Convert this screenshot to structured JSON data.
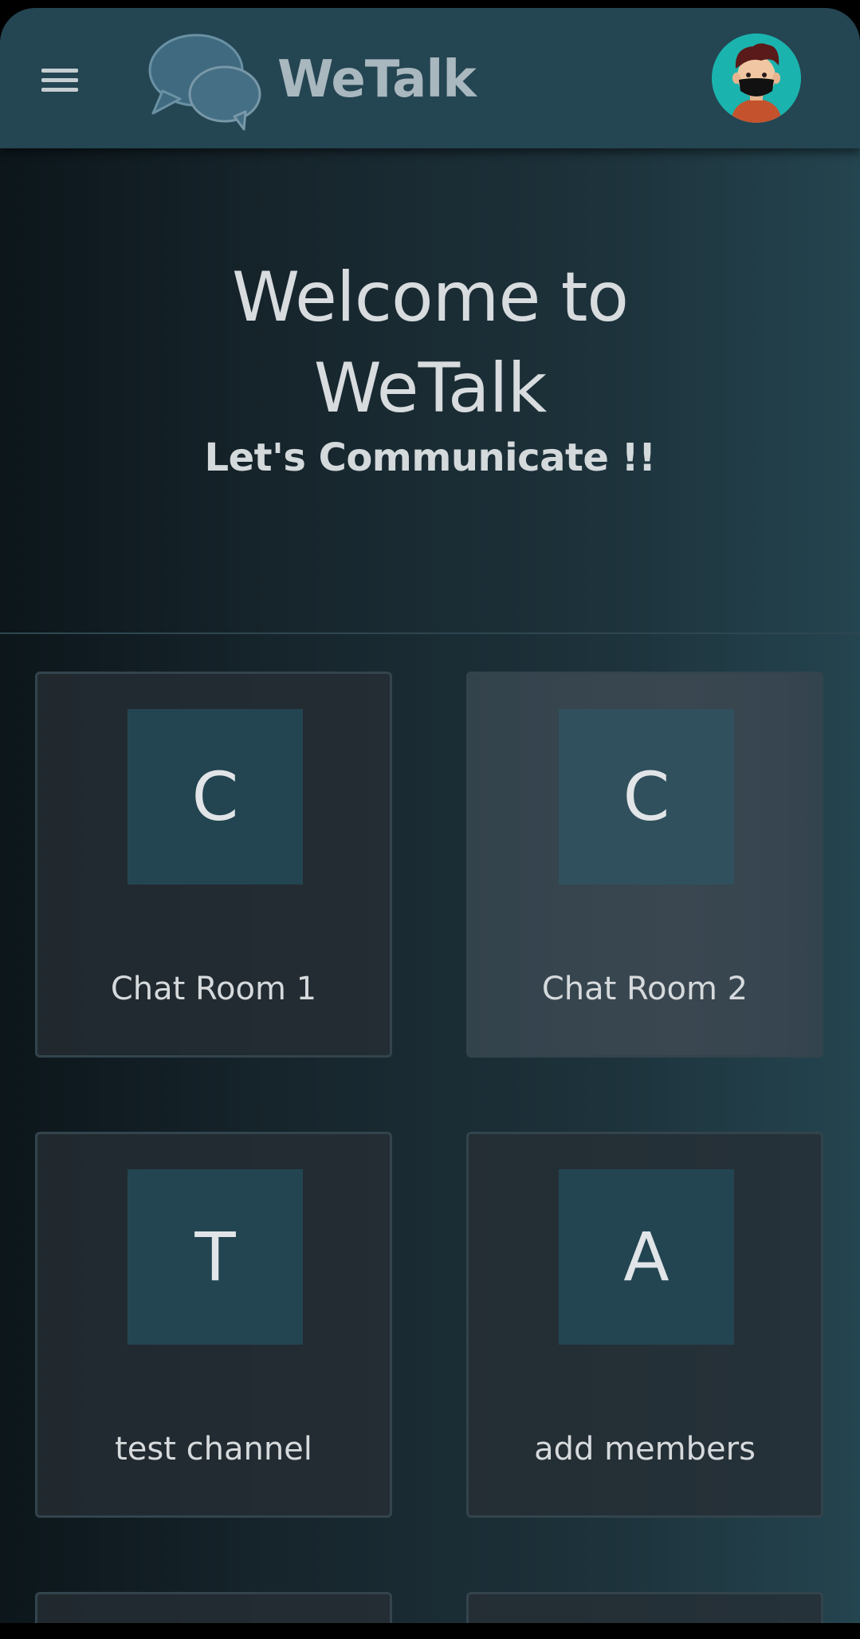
{
  "header": {
    "app_name": "WeTalk",
    "menu_icon": "hamburger-menu-icon",
    "logo_icon": "chat-bubbles-icon",
    "avatar_icon": "user-avatar-masked"
  },
  "hero": {
    "title_line1": "Welcome to",
    "title_line2": "WeTalk",
    "subtitle": "Let's Communicate !!"
  },
  "channels": [
    {
      "initial": "C",
      "name": "Chat Room 1"
    },
    {
      "initial": "C",
      "name": "Chat Room 2"
    },
    {
      "initial": "T",
      "name": "test channel"
    },
    {
      "initial": "A",
      "name": "add members"
    }
  ],
  "colors": {
    "header_bg": "#244552",
    "tile_bg": "#234552",
    "avatar_bg": "#1bb3ae",
    "text": "#d8dcdf"
  }
}
